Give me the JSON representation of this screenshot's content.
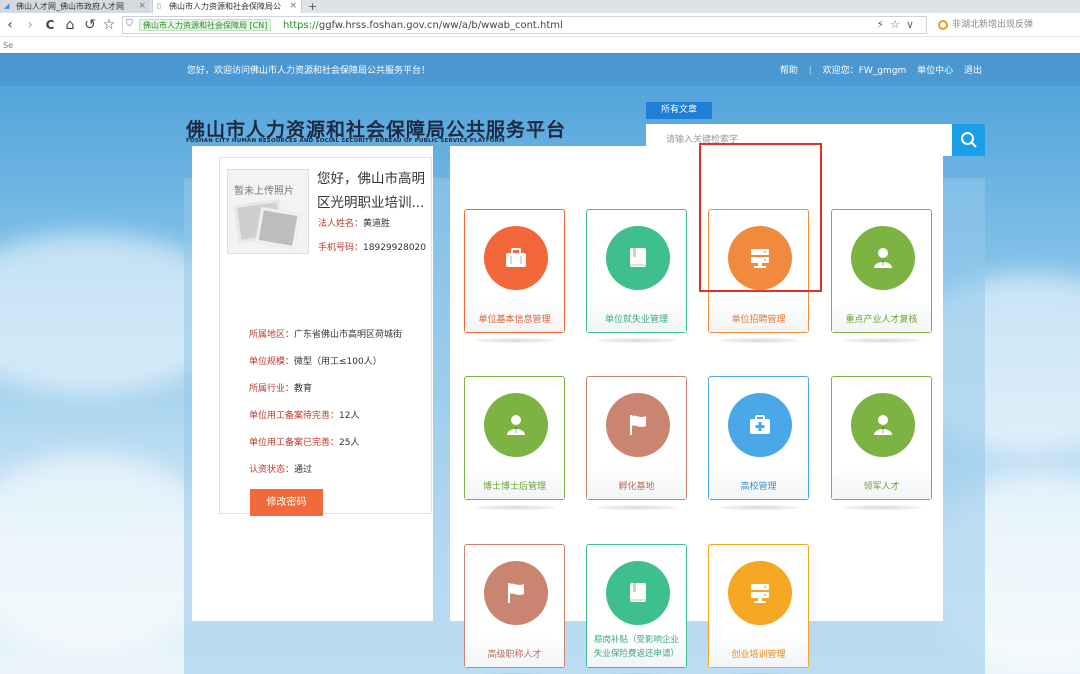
{
  "browser": {
    "tabs": [
      {
        "title": "佛山人才网_佛山市政府人才网"
      },
      {
        "title": "佛山市人力资源和社会保障局公"
      }
    ],
    "new_tab": "+",
    "nav": {
      "back": "‹",
      "forward": "›",
      "reload": "C",
      "home": "⌂",
      "undo": "↺",
      "star": "☆"
    },
    "secure_label": "佛山市人力资源和社会保障局 [CN]",
    "url_proto": "https://",
    "url_rest": "ggfw.hrss.foshan.gov.cn/ww/a/b/wwab_cont.html",
    "search_text": "非湖北新增出现反弹",
    "bookmarks_text": "Se"
  },
  "header": {
    "welcome": "您好，欢迎访问佛山市人力资源和社会保障局公共服务平台！",
    "help": "帮助",
    "greeting": "欢迎您：FW_gmgm",
    "center": "单位中心",
    "logout": "退出",
    "logo_cn": "佛山市人力资源和社会保障局公共服务平台",
    "logo_en": "FOSHAN CITY HUMAN RESOURCES AND SOCIAL SECURITY BUREAU OF PUBLIC SERVICE PLATFORM",
    "all_articles": "所有文章",
    "search_placeholder": "请输入关键检索字"
  },
  "profile": {
    "avatar_text": "暂未上传照片",
    "hello": "您好，佛山市高明区光明职业培训...",
    "legal_label": "法人姓名：",
    "legal_value": "黄道胜",
    "phone_label": "手机号码：",
    "phone_value": "18929928020",
    "info": [
      {
        "label": "所属地区：",
        "value": "广东省佛山市高明区荷城街"
      },
      {
        "label": "单位规模：",
        "value": "微型（用工≤100人）"
      },
      {
        "label": "所属行业：",
        "value": "教育"
      },
      {
        "label": "单位用工备案待完善：",
        "value": "12人"
      },
      {
        "label": "单位用工备案已完善：",
        "value": "25人"
      },
      {
        "label": "认资状态：",
        "value": "通过"
      }
    ],
    "change_password": "修改密码"
  },
  "tiles": [
    {
      "label": "单位基本信息管理",
      "color": "#f2673a",
      "label_color": "#e85b3a",
      "icon": "briefcase-icon"
    },
    {
      "label": "单位就失业管理",
      "color": "#3fbf8e",
      "label_color": "#3aa97d",
      "icon": "book-icon"
    },
    {
      "label": "单位招聘管理",
      "color": "#f08a3c",
      "label_color": "#e07a35",
      "icon": "server-icon"
    },
    {
      "label": "重点产业人才复核",
      "color": "#7cb342",
      "label_color": "#6aa232",
      "icon": "person-icon"
    },
    {
      "label": "博士博士后管理",
      "color": "#7cb342",
      "label_color": "#6aa232",
      "icon": "person-icon"
    },
    {
      "label": "孵化基地",
      "color": "#c98570",
      "label_color": "#b56f5a",
      "icon": "flag-icon"
    },
    {
      "label": "高校管理",
      "color": "#4aa8e8",
      "label_color": "#3a90d0",
      "icon": "medkit-icon"
    },
    {
      "label": "领军人才",
      "color": "#7cb342",
      "label_color": "#6aa232",
      "icon": "person-icon"
    },
    {
      "label": "高级职称人才",
      "color": "#c98570",
      "label_color": "#b56f5a",
      "icon": "flag-icon"
    },
    {
      "label": "稳岗补贴（受影响企业失业保险费返还申请）",
      "color": "#3fbf8e",
      "label_color": "#3aa97d",
      "icon": "book-icon"
    },
    {
      "label": "创业培训管理",
      "color": "#f5a623",
      "label_color": "#e08a20",
      "icon": "server-icon"
    }
  ]
}
